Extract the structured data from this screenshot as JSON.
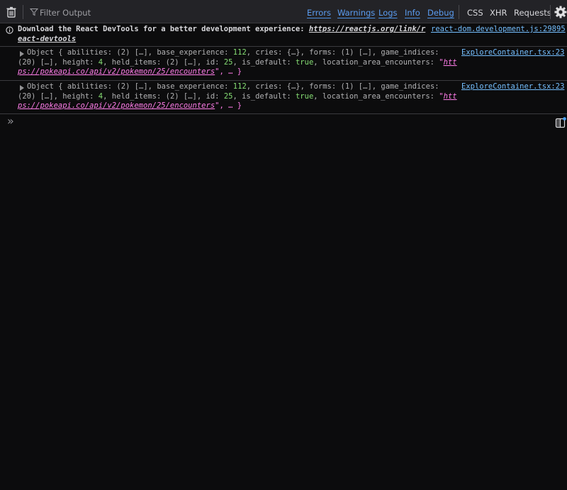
{
  "toolbar": {
    "filter_placeholder": "Filter Output",
    "levels": [
      "Errors",
      "Warnings",
      "Logs",
      "Info",
      "Debug"
    ],
    "extras": [
      "CSS",
      "XHR",
      "Requests"
    ]
  },
  "messages": [
    {
      "type": "info",
      "line1_prefix": "Download the React DevTools for a better development experience: ",
      "line1_url": "https://reactjs.org/link/r",
      "line2_url": "eact-devtools",
      "location": "react-dom.development.js:29895"
    },
    {
      "type": "log",
      "location": "ExploreContainer.tsx:23",
      "line1": "Object { abilities: (2) […], base_experience: 112, cries: {…}, forms: (1) […], game_indices:",
      "line2": "(20) […], height: 4, held_items: (2) […], id: 25, is_default: true, location_area_encounters: \"htt",
      "line3_link": "ps://pokeapi.co/api/v2/pokemon/25/encounters",
      "line3_tail": "\", … }"
    },
    {
      "type": "log",
      "location": "ExploreContainer.tsx:23",
      "line1": "Object { abilities: (2) […], base_experience: 112, cries: {…}, forms: (1) […], game_indices:",
      "line2": "(20) […], height: 4, held_items: (2) […], id: 25, is_default: true, location_area_encounters: \"htt",
      "line3_link": "ps://pokeapi.co/api/v2/pokemon/25/encounters",
      "line3_tail": "\", … }"
    }
  ],
  "prompt_symbol": "»"
}
